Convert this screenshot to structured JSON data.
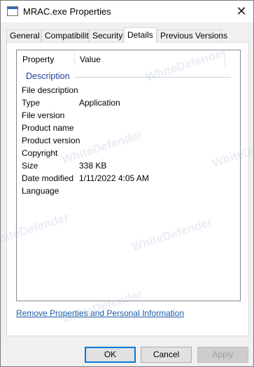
{
  "window": {
    "title": "MRAC.exe Properties",
    "close_glyph": "✕"
  },
  "tabs": [
    {
      "label": "General"
    },
    {
      "label": "Compatibility"
    },
    {
      "label": "Security"
    },
    {
      "label": "Details",
      "active": true
    },
    {
      "label": "Previous Versions"
    }
  ],
  "details": {
    "columns": {
      "property": "Property",
      "value": "Value"
    },
    "group": "Description",
    "rows": [
      {
        "property": "File description",
        "value": ""
      },
      {
        "property": "Type",
        "value": "Application"
      },
      {
        "property": "File version",
        "value": ""
      },
      {
        "property": "Product name",
        "value": ""
      },
      {
        "property": "Product version",
        "value": ""
      },
      {
        "property": "Copyright",
        "value": ""
      },
      {
        "property": "Size",
        "value": "338 KB"
      },
      {
        "property": "Date modified",
        "value": "1/11/2022 4:05 AM"
      },
      {
        "property": "Language",
        "value": ""
      }
    ]
  },
  "link": {
    "label": "Remove Properties and Personal Information"
  },
  "buttons": {
    "ok": "OK",
    "cancel": "Cancel",
    "apply": "Apply"
  },
  "watermark": {
    "text": "WhiteDefender"
  }
}
